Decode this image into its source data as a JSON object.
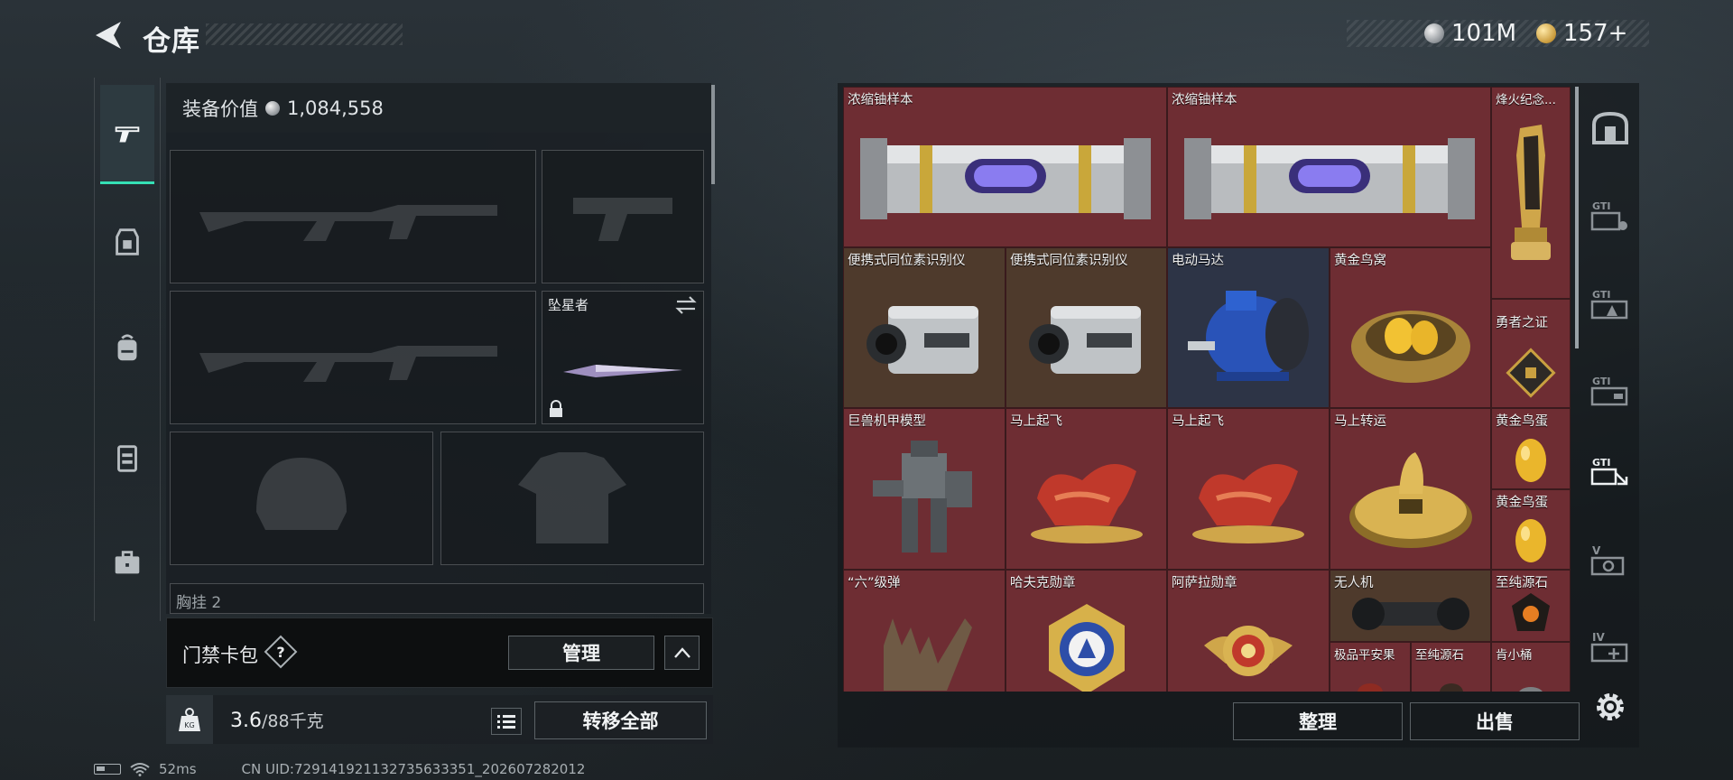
{
  "header": {
    "title": "仓库",
    "currency": [
      {
        "icon": "silver-coin-icon",
        "value": "101M"
      },
      {
        "icon": "gold-coin-icon",
        "value": "157+"
      }
    ]
  },
  "left_tabs": [
    "pistol-icon",
    "armor-vest-icon",
    "backpack-icon",
    "chest-rig-icon",
    "briefcase-icon"
  ],
  "equipment": {
    "value_label": "装备价值",
    "value": "1,084,558",
    "melee_slot_label": "坠星者",
    "next_section_label": "胸挂 2"
  },
  "access_card": {
    "title": "门禁卡包",
    "help": "?",
    "manage_label": "管理"
  },
  "weight": {
    "kg_label": "KG",
    "current": "3.6",
    "max": "/88千克",
    "transfer_all_label": "转移全部"
  },
  "status": {
    "ping": "52ms",
    "uid": "CN UID:729141921132735633351_202607282012"
  },
  "stash": {
    "items": [
      {
        "name": "浓缩铀样本",
        "icon": "uranium-canister-icon"
      },
      {
        "name": "浓缩铀样本",
        "icon": "uranium-canister-icon"
      },
      {
        "name": "烽火纪念...",
        "icon": "trophy-icon"
      },
      {
        "name": "便携式同位素识别仪",
        "icon": "isotope-detector-icon"
      },
      {
        "name": "便携式同位素识别仪",
        "icon": "isotope-detector-icon"
      },
      {
        "name": "电动马达",
        "icon": "electric-motor-icon"
      },
      {
        "name": "黄金鸟窝",
        "icon": "golden-nest-icon"
      },
      {
        "name": "勇者之证",
        "icon": "badge-icon"
      },
      {
        "name": "巨兽机甲模型",
        "icon": "mech-model-icon"
      },
      {
        "name": "马上起飞",
        "icon": "horse-statue-icon"
      },
      {
        "name": "马上起飞",
        "icon": "horse-statue-icon"
      },
      {
        "name": "马上转运",
        "icon": "golden-coin-statue-icon"
      },
      {
        "name": "黄金鸟蛋",
        "icon": "golden-egg-icon"
      },
      {
        "name": "黄金鸟蛋",
        "icon": "golden-egg-icon"
      },
      {
        "name": "“六”级弹",
        "icon": "hand-sculpture-icon"
      },
      {
        "name": "哈夫克勋章",
        "icon": "medal-icon"
      },
      {
        "name": "阿萨拉勋章",
        "icon": "medal-icon"
      },
      {
        "name": "无人机",
        "icon": "drone-part-icon"
      },
      {
        "name": "至纯源石",
        "icon": "gemstone-icon"
      },
      {
        "name": "极品平安果",
        "icon": "apple-icon"
      },
      {
        "name": "至纯源石",
        "icon": "gemstone-icon"
      },
      {
        "name": "肯小桶",
        "icon": "bucket-icon"
      }
    ],
    "sort_label": "整理",
    "sell_label": "出售"
  },
  "right_tabs": [
    "safebox-icon",
    "gti-card-icon-1",
    "gti-card-icon-2",
    "gti-card-icon-3",
    "gti-card-icon-4",
    "v-card-icon",
    "iv-card-icon",
    "gear-icon"
  ],
  "colors": {
    "accent": "#35e0b5",
    "cell_red": "#6e2d33",
    "cell_blue": "#2d3446",
    "cell_brown": "#4e3a2c"
  }
}
